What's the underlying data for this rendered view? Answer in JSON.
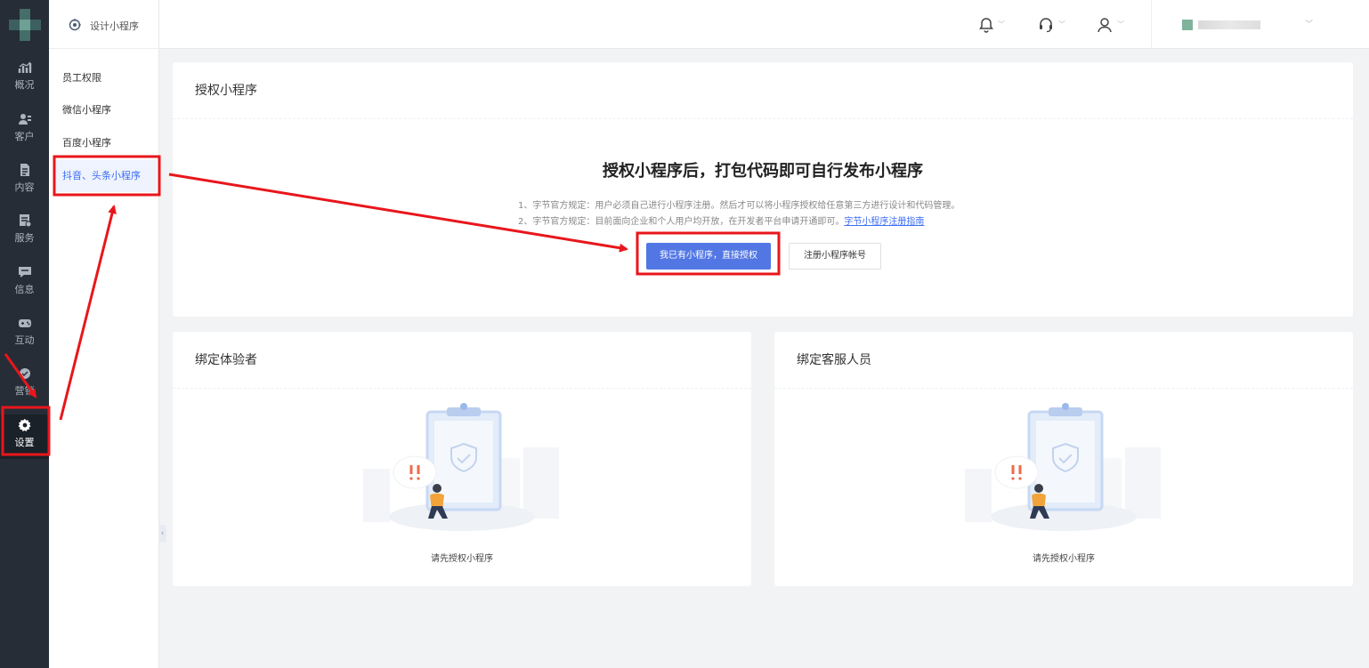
{
  "rail": {
    "items": [
      {
        "label": "概况",
        "icon": "chart-icon"
      },
      {
        "label": "客户",
        "icon": "users-icon"
      },
      {
        "label": "内容",
        "icon": "document-icon"
      },
      {
        "label": "服务",
        "icon": "service-icon"
      },
      {
        "label": "信息",
        "icon": "message-icon"
      },
      {
        "label": "互动",
        "icon": "gamepad-icon"
      },
      {
        "label": "营销",
        "icon": "marketing-icon"
      },
      {
        "label": "设置",
        "icon": "gear-icon",
        "active": true
      }
    ]
  },
  "submenu": {
    "title": "设计小程序",
    "items": [
      {
        "label": "员工权限"
      },
      {
        "label": "微信小程序"
      },
      {
        "label": "百度小程序"
      },
      {
        "label": "抖音、头条小程序",
        "active": true
      }
    ]
  },
  "topbar": {
    "icons": [
      "bell-icon",
      "headset-icon",
      "user-icon"
    ]
  },
  "authorize_card": {
    "title": "授权小程序",
    "headline": "授权小程序后，打包代码即可自行发布小程序",
    "note1": "1、字节官方规定：用户必须自己进行小程序注册。然后才可以将小程序授权给任意第三方进行设计和代码管理。",
    "note2": "2、字节官方规定：目前面向企业和个人用户均开放，在开发者平台申请开通即可。",
    "note2_link": "字节小程序注册指南",
    "primary_button": "我已有小程序，直接授权",
    "secondary_button": "注册小程序帐号"
  },
  "testers_card": {
    "title": "绑定体验者",
    "empty_text": "请先授权小程序"
  },
  "support_card": {
    "title": "绑定客服人员",
    "empty_text": "请先授权小程序"
  },
  "colors": {
    "sidebar_bg": "#262d37",
    "primary": "#5277e4",
    "link": "#3d6ef5",
    "annotation_red": "#e8161b",
    "page_bg": "#f2f3f5"
  }
}
